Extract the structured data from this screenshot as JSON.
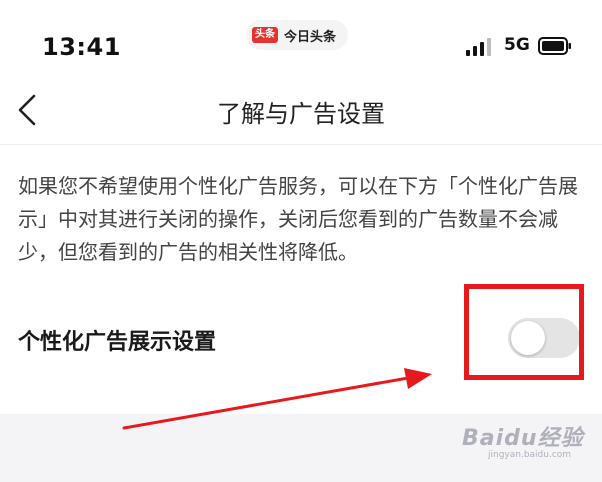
{
  "status_bar": {
    "time": "13:41",
    "app_logo": "头条",
    "app_name": "今日头条",
    "network": "5G",
    "icons": [
      "signal-icon",
      "battery-icon"
    ]
  },
  "nav": {
    "back_icon": "chevron-left-icon",
    "title": "了解与广告设置"
  },
  "description": "如果您不希望使用个性化广告服务，可以在下方「个性化广告展示」中对其进行关闭的操作，关闭后您看到的广告数量不会减少，但您看到的广告的相关性将降低。",
  "setting": {
    "label": "个性化广告展示设置",
    "toggle_on": false
  },
  "annotation": {
    "highlight_color": "#e8191c",
    "arrow_color": "#e8191c"
  },
  "watermark": {
    "text": "Baidu经验",
    "sub": "jingyan.baidu.com"
  }
}
